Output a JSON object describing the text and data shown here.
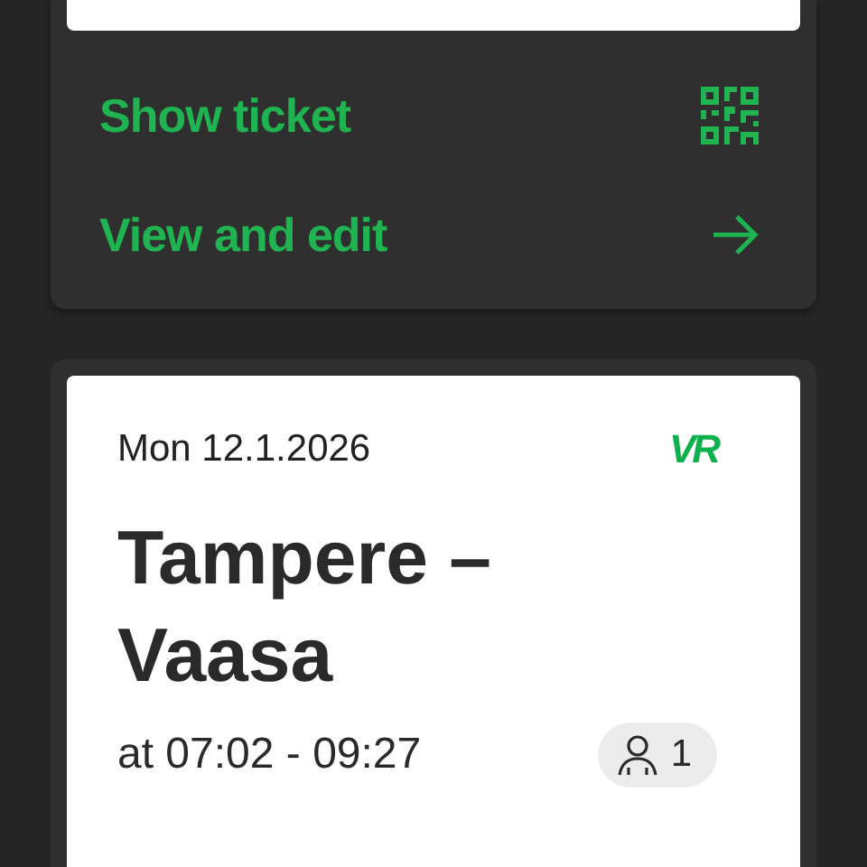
{
  "booking_actions": [
    {
      "label": "Show ticket",
      "kind": "ticket"
    },
    {
      "label": "View and edit",
      "kind": "details"
    }
  ],
  "trip": {
    "date": "Mon 12.1.2026",
    "logo": "VR",
    "route": "Tampere – Vaasa",
    "time": "at 07:02 - 09:27",
    "passengers": "1"
  }
}
